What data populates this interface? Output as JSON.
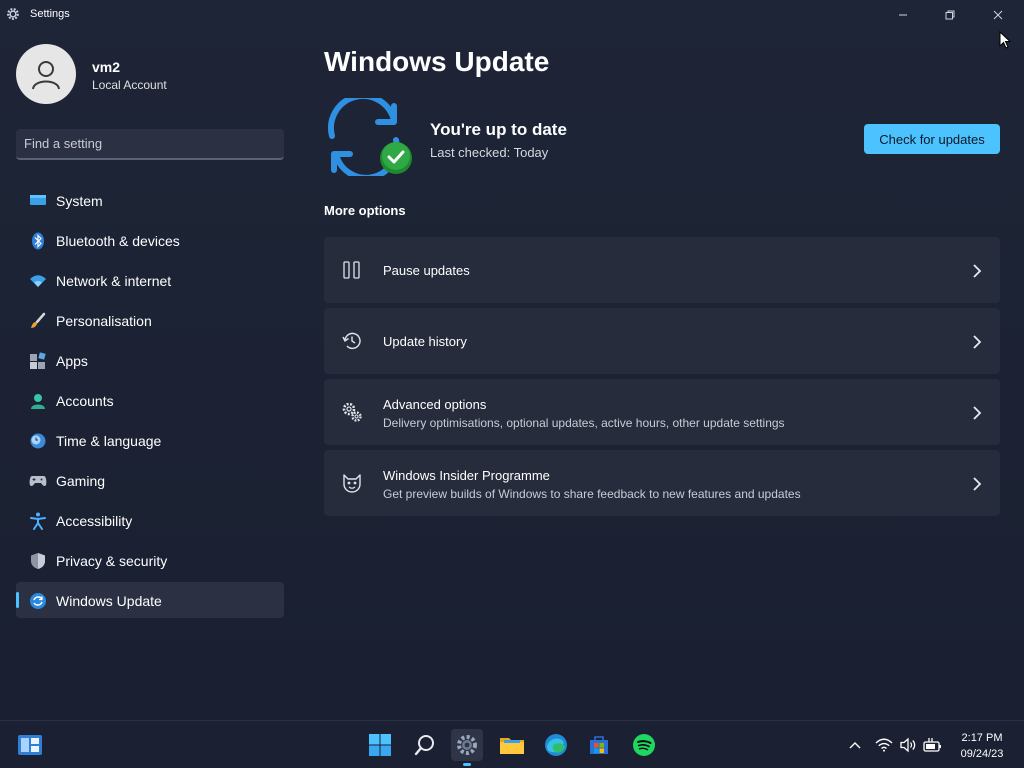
{
  "window": {
    "title": "Settings"
  },
  "profile": {
    "name": "vm2",
    "account_type": "Local Account"
  },
  "search": {
    "placeholder": "Find a setting"
  },
  "nav": {
    "items": [
      {
        "label": "System",
        "icon": "monitor-icon"
      },
      {
        "label": "Bluetooth & devices",
        "icon": "bluetooth-icon"
      },
      {
        "label": "Network & internet",
        "icon": "wifi-icon"
      },
      {
        "label": "Personalisation",
        "icon": "brush-icon"
      },
      {
        "label": "Apps",
        "icon": "apps-icon"
      },
      {
        "label": "Accounts",
        "icon": "person-icon"
      },
      {
        "label": "Time & language",
        "icon": "clock-globe-icon"
      },
      {
        "label": "Gaming",
        "icon": "gamepad-icon"
      },
      {
        "label": "Accessibility",
        "icon": "accessibility-icon"
      },
      {
        "label": "Privacy & security",
        "icon": "shield-icon"
      },
      {
        "label": "Windows Update",
        "icon": "update-icon",
        "active": true
      }
    ]
  },
  "main": {
    "title": "Windows Update",
    "status_title": "You're up to date",
    "status_sub": "Last checked: Today",
    "check_button": "Check for updates",
    "more_options": "More options",
    "options": [
      {
        "title": "Pause updates",
        "desc": ""
      },
      {
        "title": "Update history",
        "desc": ""
      },
      {
        "title": "Advanced options",
        "desc": "Delivery optimisations, optional updates, active hours, other update settings"
      },
      {
        "title": "Windows Insider Programme",
        "desc": "Get preview builds of Windows to share feedback to new features and updates"
      }
    ]
  },
  "taskbar": {
    "time": "2:17 PM",
    "date": "09/24/23"
  },
  "colors": {
    "accent": "#4cc2ff",
    "background": "#1e2536",
    "card": "#262c3c"
  }
}
